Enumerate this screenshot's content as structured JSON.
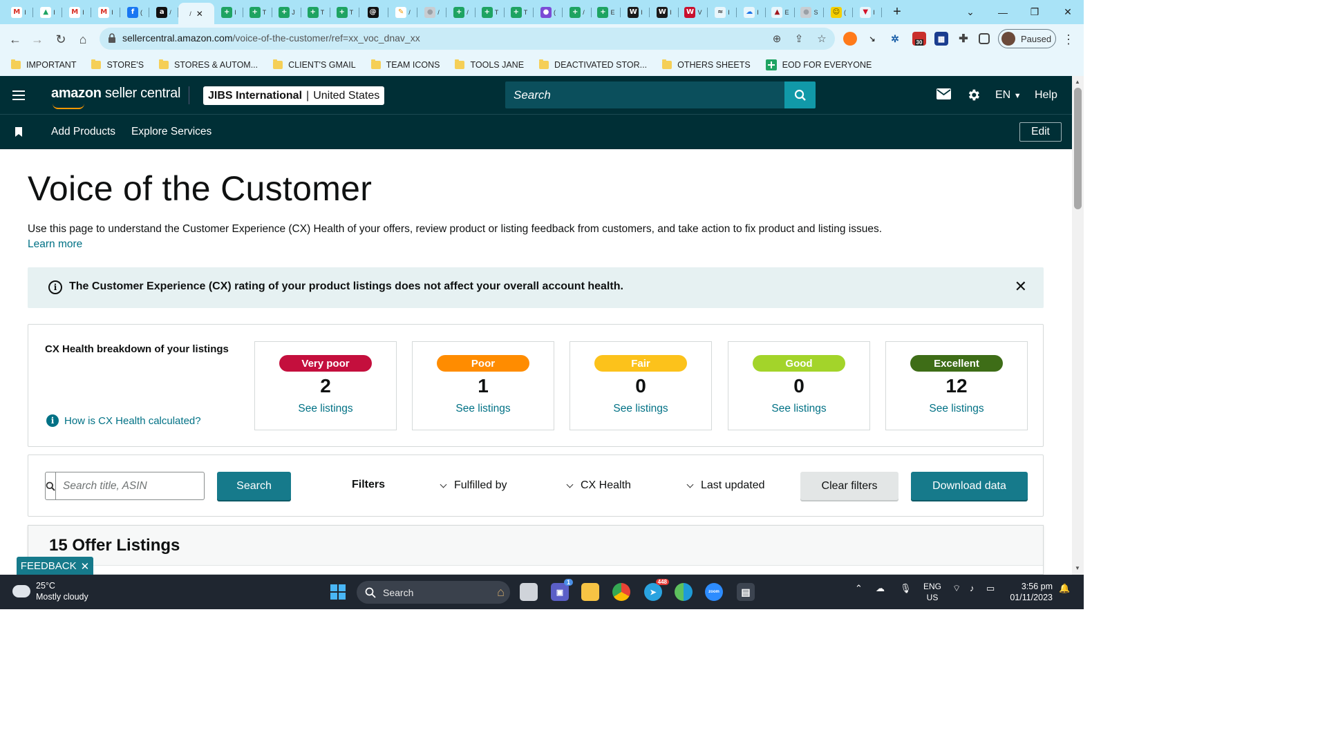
{
  "browser": {
    "tabs": [
      {
        "icon": "gmail-icon",
        "text": "I",
        "color": "#ffffff",
        "glyph": "M",
        "glyph_color": "#d93025"
      },
      {
        "icon": "drive-icon",
        "text": "I",
        "color": "#ffffff",
        "glyph": "▲",
        "glyph_color": "#1fa463"
      },
      {
        "icon": "gmail-icon",
        "text": "I",
        "color": "#ffffff",
        "glyph": "M",
        "glyph_color": "#d93025"
      },
      {
        "icon": "gmail-icon",
        "text": "I",
        "color": "#ffffff",
        "glyph": "M",
        "glyph_color": "#d93025"
      },
      {
        "icon": "facebook-icon",
        "text": "(",
        "color": "#1877f2",
        "glyph": "f",
        "glyph_color": "#ffffff"
      },
      {
        "icon": "amazon-icon",
        "text": "/",
        "color": "#111111",
        "glyph": "a",
        "glyph_color": "#ffffff"
      },
      {
        "icon": "sheets-icon",
        "text": "I",
        "color": "#1ea362",
        "glyph": "+",
        "glyph_color": "#ffffff"
      },
      {
        "icon": "sheets-icon",
        "text": "T",
        "color": "#1ea362",
        "glyph": "+",
        "glyph_color": "#ffffff"
      },
      {
        "icon": "sheets-icon",
        "text": "J",
        "color": "#1ea362",
        "glyph": "+",
        "glyph_color": "#ffffff"
      },
      {
        "icon": "sheets-icon",
        "text": "T",
        "color": "#1ea362",
        "glyph": "+",
        "glyph_color": "#ffffff"
      },
      {
        "icon": "sheets-icon",
        "text": "T",
        "color": "#1ea362",
        "glyph": "+",
        "glyph_color": "#ffffff"
      },
      {
        "icon": "threads-icon",
        "text": "",
        "color": "#111111",
        "glyph": "@",
        "glyph_color": "#ffffff"
      },
      {
        "icon": "pen-icon",
        "text": "/",
        "color": "#ffffff",
        "glyph": "✎",
        "glyph_color": "#f29900"
      },
      {
        "icon": "globe-icon",
        "text": "/",
        "color": "#c8cdd2",
        "glyph": "●",
        "glyph_color": "#9aa0a6"
      },
      {
        "icon": "sheets-icon",
        "text": "/",
        "color": "#1ea362",
        "glyph": "+",
        "glyph_color": "#ffffff"
      },
      {
        "icon": "sheets-icon",
        "text": "T",
        "color": "#1ea362",
        "glyph": "+",
        "glyph_color": "#ffffff"
      },
      {
        "icon": "sheets-icon",
        "text": "T",
        "color": "#1ea362",
        "glyph": "+",
        "glyph_color": "#ffffff"
      },
      {
        "icon": "chat-icon",
        "text": "(",
        "color": "#7b4bd6",
        "glyph": "●",
        "glyph_color": "#ffffff"
      },
      {
        "icon": "sheets-icon",
        "text": "/",
        "color": "#1ea362",
        "glyph": "+",
        "glyph_color": "#ffffff"
      },
      {
        "icon": "sheets-icon",
        "text": "E",
        "color": "#1ea362",
        "glyph": "+",
        "glyph_color": "#ffffff"
      },
      {
        "icon": "w-icon",
        "text": "I",
        "color": "#1a1a1a",
        "glyph": "W",
        "glyph_color": "#ffffff"
      },
      {
        "icon": "w-icon",
        "text": "I",
        "color": "#1a1a1a",
        "glyph": "W",
        "glyph_color": "#ffffff"
      },
      {
        "icon": "vw-icon",
        "text": "V",
        "color": "#c8102e",
        "glyph": "W",
        "glyph_color": "#ffffff"
      },
      {
        "icon": "fish-icon",
        "text": "I",
        "color": "#e8f6fc",
        "glyph": "≈",
        "glyph_color": "#333333"
      },
      {
        "icon": "cloud-icon",
        "text": "I",
        "color": "#e8f6fc",
        "glyph": "☁",
        "glyph_color": "#1a73e8"
      },
      {
        "icon": "mountain-icon",
        "text": "E",
        "color": "#e8f6fc",
        "glyph": "▲",
        "glyph_color": "#a3171e"
      },
      {
        "icon": "globe-icon",
        "text": "S",
        "color": "#c8cdd2",
        "glyph": "●",
        "glyph_color": "#9aa0a6"
      },
      {
        "icon": "smiley-icon",
        "text": "(",
        "color": "#f5cf00",
        "glyph": "☺",
        "glyph_color": "#5a4a00"
      },
      {
        "icon": "shield-icon",
        "text": "I",
        "color": "#e8f6fc",
        "glyph": "▼",
        "glyph_color": "#d4122a"
      }
    ],
    "url_host": "sellercentral.amazon.com",
    "url_path": "/voice-of-the-customer/ref=xx_voc_dnav_xx",
    "profile_label": "Paused",
    "ext_badge": "30",
    "bookmarks": [
      {
        "label": "IMPORTANT",
        "type": "folder"
      },
      {
        "label": "STORE'S",
        "type": "folder"
      },
      {
        "label": "STORES & AUTOM...",
        "type": "folder"
      },
      {
        "label": "CLIENT'S GMAIL",
        "type": "folder"
      },
      {
        "label": "TEAM ICONS",
        "type": "folder"
      },
      {
        "label": "TOOLS JANE",
        "type": "folder"
      },
      {
        "label": "DEACTIVATED STOR...",
        "type": "folder"
      },
      {
        "label": "OTHERS SHEETS",
        "type": "folder"
      },
      {
        "label": "EOD FOR EVERYONE",
        "type": "sheet"
      }
    ]
  },
  "header": {
    "logo_bold": "amazon",
    "logo_rest": " seller central",
    "store_name": "JIBS International",
    "store_region": "United States",
    "search_placeholder": "Search",
    "lang": "EN",
    "help": "Help"
  },
  "subnav": {
    "links": [
      "Add Products",
      "Explore Services"
    ],
    "edit": "Edit"
  },
  "page": {
    "title": "Voice of the Customer",
    "description": "Use this page to understand the Customer Experience (CX) Health of your offers, review product or listing feedback from customers, and take action to fix product and listing issues.",
    "learn_more": "Learn more",
    "alert": "The Customer Experience (CX) rating of your product listings does not affect your overall account health."
  },
  "cx": {
    "label": "CX Health breakdown of your listings",
    "how_link": "How is CX Health calculated?",
    "cards": [
      {
        "name": "Very poor",
        "count": "2",
        "link": "See listings",
        "color": "#c40f3d"
      },
      {
        "name": "Poor",
        "count": "1",
        "link": "See listings",
        "color": "#ff8c00"
      },
      {
        "name": "Fair",
        "count": "0",
        "link": "See listings",
        "color": "#fcc21b"
      },
      {
        "name": "Good",
        "count": "0",
        "link": "See listings",
        "color": "#a3d42a"
      },
      {
        "name": "Excellent",
        "count": "12",
        "link": "See listings",
        "color": "#3e6d17"
      }
    ]
  },
  "filters": {
    "search_placeholder": "Search title, ASIN",
    "search_button": "Search",
    "filters_label": "Filters",
    "fulfilled_by": "Fulfilled by",
    "cx_health": "CX Health",
    "last_updated": "Last updated",
    "clear": "Clear filters",
    "download": "Download data"
  },
  "listings": {
    "title": "15 Offer Listings"
  },
  "feedback": "FEEDBACK",
  "taskbar": {
    "temp": "25°C",
    "weather": "Mostly cloudy",
    "search": "Search",
    "lang1": "ENG",
    "lang2": "US",
    "time": "3:56 pm",
    "date": "01/11/2023",
    "badge_teams": "1",
    "badge_telegram": "448"
  }
}
